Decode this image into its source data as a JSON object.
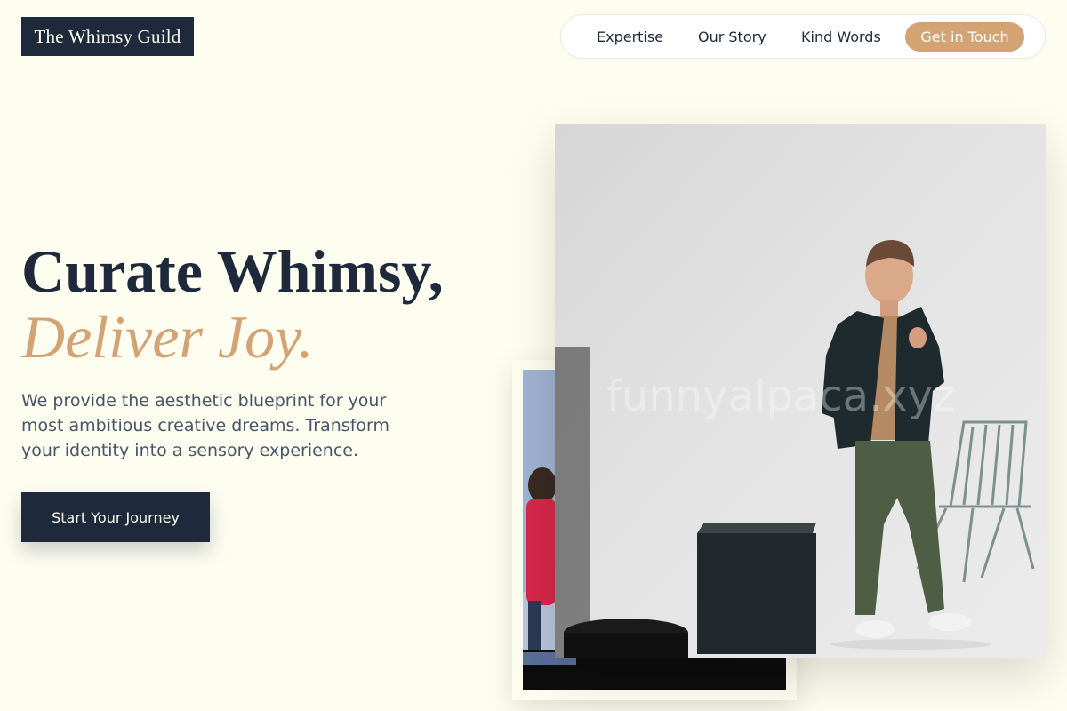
{
  "header": {
    "logo_text": "The Whimsy Guild",
    "nav": {
      "links": [
        "Expertise",
        "Our Story",
        "Kind Words"
      ],
      "cta_label": "Get in Touch"
    }
  },
  "hero": {
    "title": "Curate Whimsy,",
    "accent": "Deliver Joy.",
    "description": "We provide the aesthetic blueprint for your most ambitious creative dreams. Transform your identity into a sensory experience.",
    "cta_label": "Start Your Journey"
  },
  "gallery": {
    "watermark": "funnyalpaca.xyz",
    "main_photo_subject": "man in dark blazer standing in white studio with chair and black cube",
    "secondary_photo_subject": "person in red top beside a framed photo"
  },
  "colors": {
    "background": "#fdfdf0",
    "navy": "#1e293b",
    "accent": "#d4a373"
  }
}
